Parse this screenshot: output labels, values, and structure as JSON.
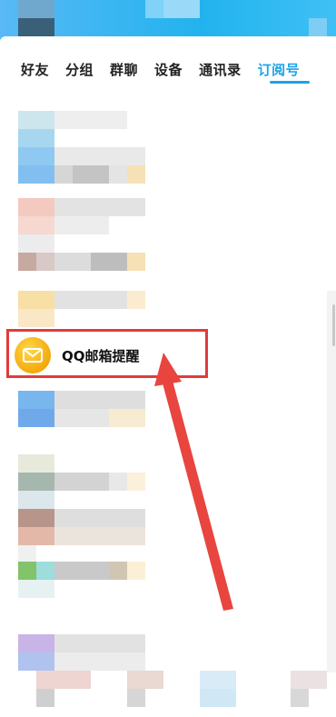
{
  "tabs": [
    {
      "label": "好友"
    },
    {
      "label": "分组"
    },
    {
      "label": "群聊"
    },
    {
      "label": "设备"
    },
    {
      "label": "通讯录"
    },
    {
      "label": "订阅号",
      "active": true
    }
  ],
  "highlighted_item": {
    "title": "QQ邮箱提醒",
    "icon": "mail-icon"
  },
  "colors": {
    "accent": "#1aa3e8",
    "highlight_box": "#e23b3b",
    "arrow": "#e8453f",
    "mail_icon": "#f5b310"
  }
}
